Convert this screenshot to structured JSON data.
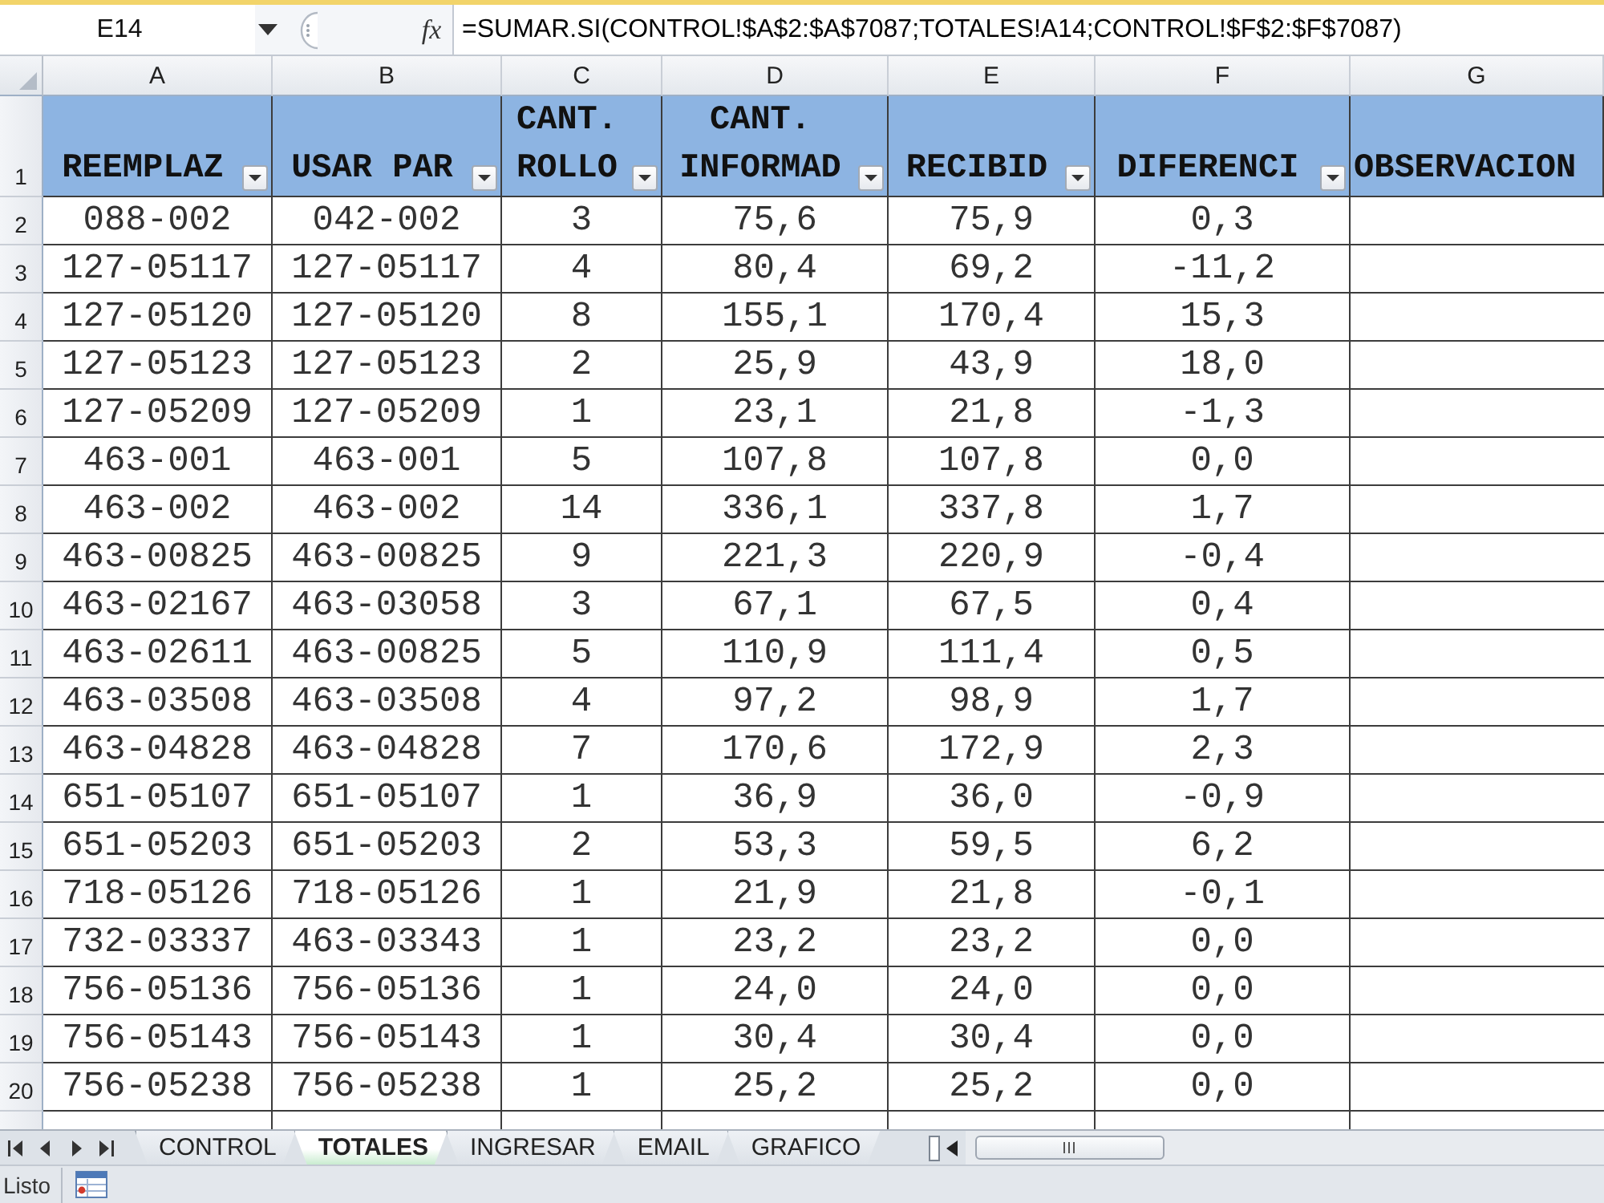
{
  "formula_bar": {
    "name_box": "E14",
    "function_label": "fx",
    "formula": "=SUMAR.SI(CONTROL!$A$2:$A$7087;TOTALES!A14;CONTROL!$F$2:$F$7087)"
  },
  "columns": [
    "A",
    "B",
    "C",
    "D",
    "E",
    "F",
    "G"
  ],
  "header_row": {
    "number": "1",
    "cells": [
      {
        "text": "REEMPLAZ",
        "filter": true
      },
      {
        "text": "USAR PAR",
        "filter": true
      },
      {
        "text": "CANT. ROLLO",
        "filter": true
      },
      {
        "text": "CANT. INFORMAD",
        "filter": true
      },
      {
        "text": "RECIBID",
        "filter": true
      },
      {
        "text": "DIFERENCI",
        "filter": true
      },
      {
        "text": "OBSERVACION",
        "filter": false
      }
    ]
  },
  "rows": [
    {
      "number": "2",
      "cells": [
        "088-002",
        "042-002",
        "3",
        "75,6",
        "75,9",
        "0,3"
      ]
    },
    {
      "number": "3",
      "cells": [
        "127-05117",
        "127-05117",
        "4",
        "80,4",
        "69,2",
        "-11,2"
      ]
    },
    {
      "number": "4",
      "cells": [
        "127-05120",
        "127-05120",
        "8",
        "155,1",
        "170,4",
        "15,3"
      ]
    },
    {
      "number": "5",
      "cells": [
        "127-05123",
        "127-05123",
        "2",
        "25,9",
        "43,9",
        "18,0"
      ]
    },
    {
      "number": "6",
      "cells": [
        "127-05209",
        "127-05209",
        "1",
        "23,1",
        "21,8",
        "-1,3"
      ]
    },
    {
      "number": "7",
      "cells": [
        "463-001",
        "463-001",
        "5",
        "107,8",
        "107,8",
        "0,0"
      ]
    },
    {
      "number": "8",
      "cells": [
        "463-002",
        "463-002",
        "14",
        "336,1",
        "337,8",
        "1,7"
      ]
    },
    {
      "number": "9",
      "cells": [
        "463-00825",
        "463-00825",
        "9",
        "221,3",
        "220,9",
        "-0,4"
      ]
    },
    {
      "number": "10",
      "cells": [
        "463-02167",
        "463-03058",
        "3",
        "67,1",
        "67,5",
        "0,4"
      ]
    },
    {
      "number": "11",
      "cells": [
        "463-02611",
        "463-00825",
        "5",
        "110,9",
        "111,4",
        "0,5"
      ]
    },
    {
      "number": "12",
      "cells": [
        "463-03508",
        "463-03508",
        "4",
        "97,2",
        "98,9",
        "1,7"
      ]
    },
    {
      "number": "13",
      "cells": [
        "463-04828",
        "463-04828",
        "7",
        "170,6",
        "172,9",
        "2,3"
      ]
    },
    {
      "number": "14",
      "cells": [
        "651-05107",
        "651-05107",
        "1",
        "36,9",
        "36,0",
        "-0,9"
      ]
    },
    {
      "number": "15",
      "cells": [
        "651-05203",
        "651-05203",
        "2",
        "53,3",
        "59,5",
        "6,2"
      ]
    },
    {
      "number": "16",
      "cells": [
        "718-05126",
        "718-05126",
        "1",
        "21,9",
        "21,8",
        "-0,1"
      ]
    },
    {
      "number": "17",
      "cells": [
        "732-03337",
        "463-03343",
        "1",
        "23,2",
        "23,2",
        "0,0"
      ]
    },
    {
      "number": "18",
      "cells": [
        "756-05136",
        "756-05136",
        "1",
        "24,0",
        "24,0",
        "0,0"
      ]
    },
    {
      "number": "19",
      "cells": [
        "756-05143",
        "756-05143",
        "1",
        "30,4",
        "30,4",
        "0,0"
      ]
    },
    {
      "number": "20",
      "cells": [
        "756-05238",
        "756-05238",
        "1",
        "25,2",
        "25,2",
        "0,0"
      ]
    }
  ],
  "sheet_tabs": [
    {
      "label": "CONTROL",
      "selected": false
    },
    {
      "label": "TOTALES",
      "selected": true
    },
    {
      "label": "INGRESAR",
      "selected": false
    },
    {
      "label": "EMAIL",
      "selected": false
    },
    {
      "label": "GRAFICO",
      "selected": false
    }
  ],
  "status_bar": {
    "text": "Listo"
  }
}
